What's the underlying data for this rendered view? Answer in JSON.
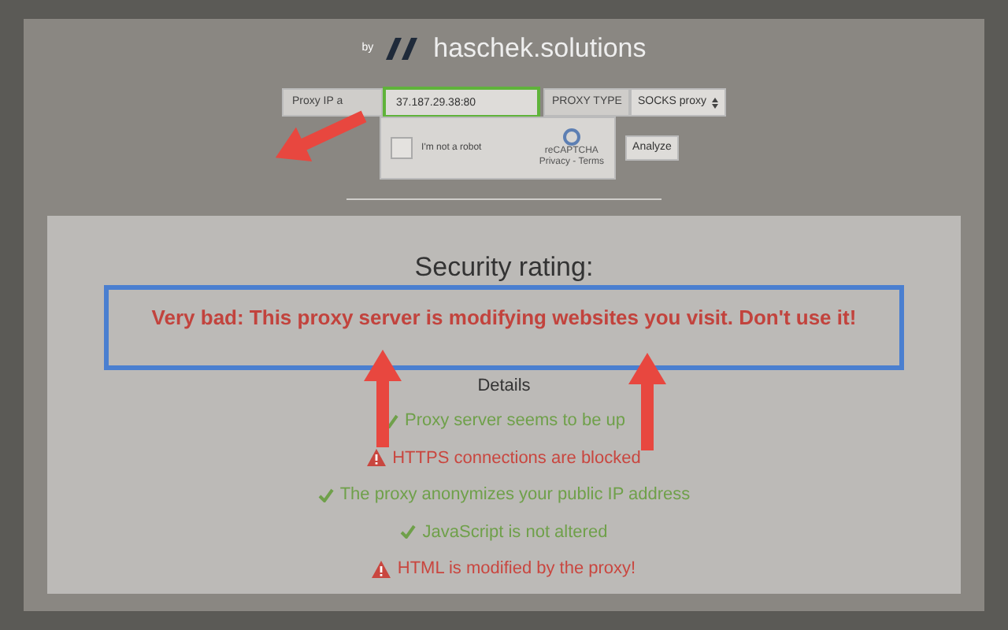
{
  "brand": {
    "by": "by",
    "name": "haschek.solutions"
  },
  "form": {
    "ip_label": "Proxy IP a",
    "ip_value": "37.187.29.38:80",
    "type_label": "PROXY TYPE",
    "type_value": "SOCKS proxy",
    "captcha_checked": false,
    "captcha_label": "I'm not a robot",
    "captcha_brand": "reCAPTCHA",
    "captcha_links": "Privacy - Terms",
    "analyze": "Analyze"
  },
  "result": {
    "heading": "Security rating:",
    "verdict": "Very bad: This proxy server is modifying websites you visit. Don't use it!",
    "details_heading": "Details",
    "items": [
      {
        "kind": "ok",
        "text": "Proxy server seems to be up"
      },
      {
        "kind": "warn",
        "text": "HTTPS connections are blocked"
      },
      {
        "kind": "ok",
        "text": "The proxy anonymizes your public IP address"
      },
      {
        "kind": "ok",
        "text": "JavaScript is not altered"
      },
      {
        "kind": "warn",
        "text": "HTML is modified by the proxy!"
      }
    ]
  }
}
